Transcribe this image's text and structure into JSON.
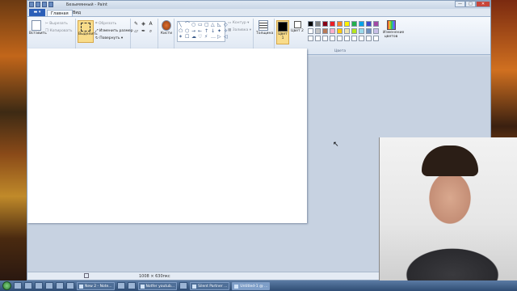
{
  "window": {
    "title": "Безымянный - Paint",
    "controls": [
      "—",
      "□",
      "✕"
    ]
  },
  "tabs": {
    "file": "",
    "home": "Главная",
    "view": "Вид"
  },
  "ribbon": {
    "clipboard": {
      "paste": "Вставить",
      "cut": "Вырезать",
      "copy": "Копировать",
      "label": "Буфер обмена"
    },
    "image": {
      "select": "Выделить",
      "crop": "Обрезать",
      "resize": "Изменить размер",
      "rotate": "Повернуть ▾",
      "label": "Изображение"
    },
    "tools": {
      "label": "Инструменты",
      "icons": [
        "pencil-icon",
        "fill-icon",
        "text-icon",
        "eraser-icon",
        "color-picker-icon",
        "magnifier-icon"
      ]
    },
    "brushes": {
      "label": "Кисти"
    },
    "shapes": {
      "label": "Фигуры",
      "outline": "Контур ▾",
      "fill": "Заливка ▾",
      "glyphs": [
        "╲",
        "⌒",
        "○",
        "▭",
        "▢",
        "△",
        "◺",
        "◇",
        "⬠",
        "⬡",
        "→",
        "←",
        "↑",
        "↓",
        "✦",
        "✧",
        "✶",
        "☐",
        "☁",
        "♡",
        "⚡",
        "…",
        "▷",
        "◁"
      ]
    },
    "size": {
      "label": "Толщина"
    },
    "colors": {
      "color1": "Цвет 1",
      "color2": "Цвет 2",
      "edit": "Изменение цветов",
      "label": "Цвета",
      "color1_value": "#000000",
      "color2_value": "#ffffff",
      "palette": [
        "#000000",
        "#7f7f7f",
        "#880015",
        "#ed1c24",
        "#ff7f27",
        "#fff200",
        "#22b14c",
        "#00a2e8",
        "#3f48cc",
        "#a349a4",
        "#ffffff",
        "#c3c3c3",
        "#b97a57",
        "#ffaec9",
        "#ffc90e",
        "#efe4b0",
        "#b5e61d",
        "#99d9ea",
        "#7092be",
        "#c8bfe7",
        "#ffffff",
        "#ffffff",
        "#ffffff",
        "#ffffff",
        "#ffffff",
        "#ffffff",
        "#ffffff",
        "#ffffff",
        "#ffffff",
        "#ffffff"
      ]
    }
  },
  "status": {
    "canvas_size": "1008 × 630пкс"
  },
  "taskbar": {
    "apps": [
      "New 2 - Note...",
      "",
      "",
      "Notfer youtub...",
      "",
      "Silent Partner ...",
      "Untitled-1 @ ..."
    ]
  }
}
